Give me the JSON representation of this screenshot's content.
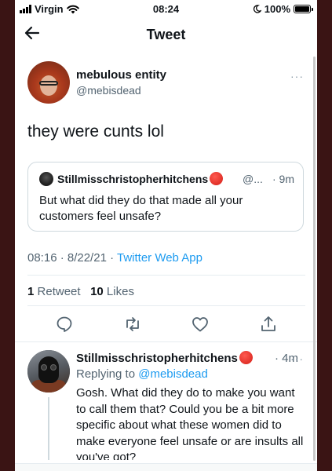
{
  "status_bar": {
    "carrier": "Virgin",
    "time": "08:24",
    "battery": "100%",
    "battery_level": 1.0
  },
  "nav": {
    "title": "Tweet",
    "back_icon": "arrow-left-icon"
  },
  "tweet": {
    "author_name": "mebulous entity",
    "author_handle": "@mebisdead",
    "text": "they were cunts lol",
    "more": "···",
    "quote": {
      "author_name": "Stillmisschristopherhitchens",
      "author_handle": "@...",
      "time": "· 9m",
      "text": "But what did they do that made all your customers feel unsafe?"
    },
    "timestamp": "08:16 · 8/22/21 · ",
    "source": "Twitter Web App",
    "retweets": "1",
    "retweets_label": "Retweet",
    "likes": "10",
    "likes_label": "Likes",
    "actions": [
      "reply-icon",
      "retweet-icon",
      "like-icon",
      "share-icon"
    ]
  },
  "reply": {
    "author_name": "Stillmisschristopherhitchens",
    "time": "· 4m",
    "more": "···",
    "replying_to_label": "Replying to ",
    "replying_to_handle": "@mebisdead",
    "text": "Gosh. What did they do to make you want to call them that? Could you be a bit more specific about what these women did to make everyone feel unsafe or are insults all you've got?"
  },
  "colors": {
    "accent": "#1d9bf0",
    "badge": "#e0241c",
    "secondary_text": "#536471"
  }
}
